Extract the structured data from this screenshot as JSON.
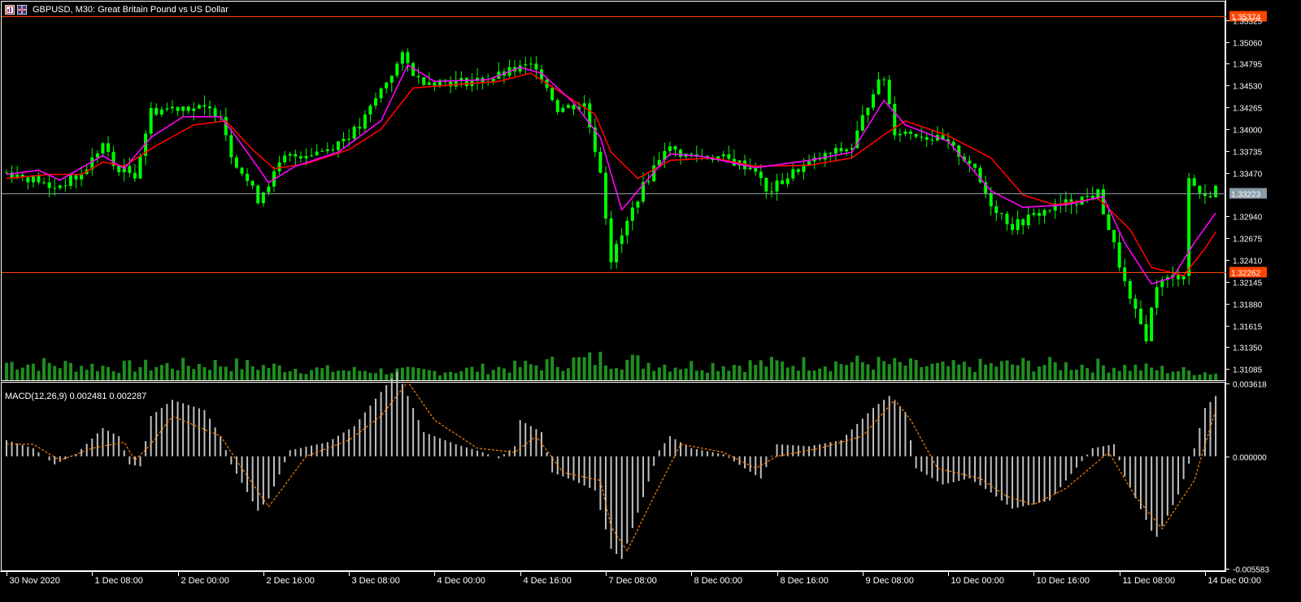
{
  "window": {
    "symbol_title": "GBPUSD, M30:  Great Britain Pound vs US Dollar"
  },
  "indicator": {
    "macd_label": "MACD(12,26,9) 0.002481 0.002287"
  },
  "colors": {
    "background": "#000000",
    "axis": "#ffffff",
    "candle": "#00ff00",
    "volume": "#1f8f1f",
    "ma_fast": "#ff00ff",
    "ma_slow": "#ff0000",
    "price_line_orange": "#ff4500",
    "price_line_gray": "#8a9ba8",
    "macd_hist": "#c0c0c0",
    "macd_signal": "#ff7f00"
  },
  "chart_data": [
    {
      "type": "line",
      "subtype": "candlestick",
      "title": "GBPUSD, M30:  Great Britain Pound vs US Dollar",
      "x_tick_labels": [
        "30 Nov 2020",
        "1 Dec 08:00",
        "2 Dec 00:00",
        "2 Dec 16:00",
        "3 Dec 08:00",
        "4 Dec 00:00",
        "4 Dec 16:00",
        "7 Dec 08:00",
        "8 Dec 00:00",
        "8 Dec 16:00",
        "9 Dec 08:00",
        "10 Dec 00:00",
        "10 Dec 16:00",
        "11 Dec 08:00",
        "14 Dec 00:00"
      ],
      "x_tick_index": [
        0,
        16,
        32,
        48,
        64,
        80,
        96,
        112,
        128,
        144,
        160,
        176,
        192,
        208,
        224
      ],
      "y_tick_labels": [
        "1.35325",
        "1.35060",
        "1.34795",
        "1.34530",
        "1.34265",
        "1.34000",
        "1.33735",
        "1.33470",
        "1.32940",
        "1.32675",
        "1.32410",
        "1.32145",
        "1.31880",
        "1.31615",
        "1.31350",
        "1.31085"
      ],
      "ylim": [
        1.3095,
        1.3545
      ],
      "price_markers": [
        {
          "label": "1.35374",
          "value": 1.35374,
          "color": "#ff4500"
        },
        {
          "label": "1.33223",
          "value": 1.33223,
          "color": "#8a9ba8"
        },
        {
          "label": "1.32262",
          "value": 1.32262,
          "color": "#ff4500"
        }
      ],
      "close_anchors": [
        [
          0,
          1.3347
        ],
        [
          6,
          1.3338
        ],
        [
          8,
          1.3327
        ],
        [
          14,
          1.3344
        ],
        [
          18,
          1.3382
        ],
        [
          20,
          1.3355
        ],
        [
          24,
          1.3345
        ],
        [
          27,
          1.3422
        ],
        [
          33,
          1.3428
        ],
        [
          40,
          1.342
        ],
        [
          42,
          1.337
        ],
        [
          47,
          1.3315
        ],
        [
          52,
          1.3365
        ],
        [
          60,
          1.3376
        ],
        [
          66,
          1.3402
        ],
        [
          70,
          1.3448
        ],
        [
          74,
          1.3488
        ],
        [
          77,
          1.346
        ],
        [
          84,
          1.3457
        ],
        [
          90,
          1.346
        ],
        [
          95,
          1.3472
        ],
        [
          99,
          1.3478
        ],
        [
          103,
          1.3425
        ],
        [
          108,
          1.343
        ],
        [
          111,
          1.335
        ],
        [
          113,
          1.3242
        ],
        [
          115,
          1.327
        ],
        [
          118,
          1.3318
        ],
        [
          123,
          1.3378
        ],
        [
          127,
          1.3368
        ],
        [
          133,
          1.3366
        ],
        [
          140,
          1.3352
        ],
        [
          142,
          1.3322
        ],
        [
          148,
          1.3352
        ],
        [
          154,
          1.337
        ],
        [
          158,
          1.3378
        ],
        [
          162,
          1.3448
        ],
        [
          164,
          1.3462
        ],
        [
          166,
          1.3398
        ],
        [
          170,
          1.3395
        ],
        [
          175,
          1.3385
        ],
        [
          180,
          1.336
        ],
        [
          184,
          1.331
        ],
        [
          188,
          1.3282
        ],
        [
          193,
          1.3298
        ],
        [
          198,
          1.331
        ],
        [
          204,
          1.3322
        ],
        [
          207,
          1.3258
        ],
        [
          210,
          1.319
        ],
        [
          213,
          1.3148
        ],
        [
          215,
          1.3212
        ],
        [
          220,
          1.3225
        ],
        [
          221,
          1.334
        ],
        [
          224,
          1.3315
        ],
        [
          226,
          1.333
        ]
      ],
      "ma_fast_anchors": [
        [
          0,
          1.3345
        ],
        [
          6,
          1.335
        ],
        [
          10,
          1.3338
        ],
        [
          18,
          1.3368
        ],
        [
          22,
          1.3352
        ],
        [
          27,
          1.339
        ],
        [
          33,
          1.3415
        ],
        [
          40,
          1.3415
        ],
        [
          43,
          1.339
        ],
        [
          49,
          1.3335
        ],
        [
          54,
          1.3355
        ],
        [
          62,
          1.3372
        ],
        [
          70,
          1.341
        ],
        [
          75,
          1.3478
        ],
        [
          80,
          1.3458
        ],
        [
          90,
          1.346
        ],
        [
          96,
          1.3475
        ],
        [
          100,
          1.3468
        ],
        [
          106,
          1.3432
        ],
        [
          111,
          1.339
        ],
        [
          115,
          1.3302
        ],
        [
          118,
          1.3325
        ],
        [
          124,
          1.337
        ],
        [
          130,
          1.3367
        ],
        [
          140,
          1.3353
        ],
        [
          150,
          1.3362
        ],
        [
          158,
          1.3372
        ],
        [
          164,
          1.3435
        ],
        [
          168,
          1.3405
        ],
        [
          176,
          1.3385
        ],
        [
          184,
          1.3325
        ],
        [
          190,
          1.3305
        ],
        [
          198,
          1.3308
        ],
        [
          205,
          1.3318
        ],
        [
          209,
          1.3262
        ],
        [
          214,
          1.3212
        ],
        [
          218,
          1.322
        ],
        [
          222,
          1.3262
        ],
        [
          226,
          1.3298
        ]
      ],
      "ma_slow_anchors": [
        [
          0,
          1.334
        ],
        [
          8,
          1.3345
        ],
        [
          14,
          1.3345
        ],
        [
          18,
          1.336
        ],
        [
          22,
          1.3355
        ],
        [
          28,
          1.338
        ],
        [
          35,
          1.3405
        ],
        [
          41,
          1.341
        ],
        [
          46,
          1.3375
        ],
        [
          50,
          1.3352
        ],
        [
          56,
          1.3358
        ],
        [
          64,
          1.3375
        ],
        [
          70,
          1.34
        ],
        [
          76,
          1.345
        ],
        [
          82,
          1.3453
        ],
        [
          92,
          1.3458
        ],
        [
          98,
          1.3468
        ],
        [
          104,
          1.3443
        ],
        [
          110,
          1.3418
        ],
        [
          113,
          1.3372
        ],
        [
          118,
          1.334
        ],
        [
          124,
          1.3362
        ],
        [
          132,
          1.3365
        ],
        [
          140,
          1.3355
        ],
        [
          150,
          1.3356
        ],
        [
          158,
          1.3365
        ],
        [
          164,
          1.3393
        ],
        [
          168,
          1.341
        ],
        [
          176,
          1.3392
        ],
        [
          184,
          1.3365
        ],
        [
          190,
          1.332
        ],
        [
          196,
          1.3308
        ],
        [
          204,
          1.3316
        ],
        [
          210,
          1.3278
        ],
        [
          214,
          1.3232
        ],
        [
          220,
          1.3222
        ],
        [
          224,
          1.3255
        ],
        [
          226,
          1.3275
        ]
      ],
      "volume_anchors": [
        [
          0,
          0.6
        ],
        [
          20,
          0.45
        ],
        [
          40,
          0.55
        ],
        [
          60,
          0.35
        ],
        [
          80,
          0.3
        ],
        [
          95,
          0.45
        ],
        [
          112,
          0.75
        ],
        [
          125,
          0.5
        ],
        [
          140,
          0.55
        ],
        [
          160,
          0.6
        ],
        [
          175,
          0.45
        ],
        [
          190,
          0.55
        ],
        [
          205,
          0.5
        ],
        [
          226,
          0.25
        ]
      ]
    },
    {
      "type": "bar",
      "title": "MACD(12,26,9) 0.002481 0.002287",
      "y_tick_labels": [
        "0.003618",
        "0.000000",
        "-0.005583"
      ],
      "ylim": [
        -0.005583,
        0.003618
      ],
      "main_value": 0.002481,
      "signal_value": 0.002287,
      "hist_anchors": [
        [
          0,
          0.0008
        ],
        [
          5,
          0.0004
        ],
        [
          9,
          -0.0004
        ],
        [
          13,
          0.0001
        ],
        [
          18,
          0.0014
        ],
        [
          21,
          0.001
        ],
        [
          23,
          -0.0004
        ],
        [
          25,
          -0.0005
        ],
        [
          27,
          0.002
        ],
        [
          31,
          0.0028
        ],
        [
          37,
          0.0023
        ],
        [
          40,
          0.001
        ],
        [
          42,
          -0.0004
        ],
        [
          47,
          -0.0027
        ],
        [
          49,
          -0.0021
        ],
        [
          53,
          0.0003
        ],
        [
          60,
          0.0007
        ],
        [
          65,
          0.0015
        ],
        [
          70,
          0.0032
        ],
        [
          73,
          0.0042
        ],
        [
          78,
          0.0012
        ],
        [
          84,
          0.0006
        ],
        [
          89,
          0.0002
        ],
        [
          92,
          -0.0001
        ],
        [
          95,
          0.0005
        ],
        [
          96,
          0.0018
        ],
        [
          100,
          0.0012
        ],
        [
          102,
          -0.0008
        ],
        [
          106,
          -0.0012
        ],
        [
          110,
          -0.0017
        ],
        [
          113,
          -0.0046
        ],
        [
          115,
          -0.0051
        ],
        [
          118,
          -0.0028
        ],
        [
          122,
          0.0003
        ],
        [
          124,
          0.001
        ],
        [
          128,
          0.0004
        ],
        [
          134,
          0.0001
        ],
        [
          138,
          -0.0006
        ],
        [
          141,
          -0.0011
        ],
        [
          144,
          0.0006
        ],
        [
          150,
          0.0005
        ],
        [
          156,
          0.0008
        ],
        [
          162,
          0.0024
        ],
        [
          165,
          0.003
        ],
        [
          168,
          0.0022
        ],
        [
          170,
          -0.0006
        ],
        [
          175,
          -0.0014
        ],
        [
          180,
          -0.0011
        ],
        [
          184,
          -0.0018
        ],
        [
          188,
          -0.0026
        ],
        [
          195,
          -0.0022
        ],
        [
          198,
          -0.0012
        ],
        [
          203,
          0.0004
        ],
        [
          207,
          0.0006
        ],
        [
          209,
          -0.001
        ],
        [
          214,
          -0.0037
        ],
        [
          215,
          -0.004
        ],
        [
          219,
          -0.0019
        ],
        [
          222,
          0.0004
        ],
        [
          224,
          0.0024
        ],
        [
          226,
          0.003
        ]
      ],
      "signal_anchors": [
        [
          0,
          0.0006
        ],
        [
          5,
          0.0006
        ],
        [
          10,
          -0.0002
        ],
        [
          16,
          0.0004
        ],
        [
          22,
          0.0007
        ],
        [
          24,
          -0.0002
        ],
        [
          27,
          0.0006
        ],
        [
          31,
          0.002
        ],
        [
          40,
          0.001
        ],
        [
          44,
          -0.0006
        ],
        [
          49,
          -0.0025
        ],
        [
          51,
          -0.0018
        ],
        [
          56,
          0.0
        ],
        [
          64,
          0.0008
        ],
        [
          70,
          0.002
        ],
        [
          75,
          0.0037
        ],
        [
          80,
          0.0018
        ],
        [
          88,
          0.0004
        ],
        [
          95,
          0.0002
        ],
        [
          99,
          0.001
        ],
        [
          104,
          -0.0008
        ],
        [
          111,
          -0.0012
        ],
        [
          113,
          -0.0035
        ],
        [
          116,
          -0.0047
        ],
        [
          121,
          -0.002
        ],
        [
          126,
          0.0006
        ],
        [
          134,
          0.0002
        ],
        [
          140,
          -0.0006
        ],
        [
          144,
          0.0
        ],
        [
          152,
          0.0004
        ],
        [
          160,
          0.001
        ],
        [
          166,
          0.0028
        ],
        [
          169,
          0.0018
        ],
        [
          174,
          -0.0006
        ],
        [
          182,
          -0.0011
        ],
        [
          187,
          -0.002
        ],
        [
          192,
          -0.0024
        ],
        [
          198,
          -0.0016
        ],
        [
          206,
          0.0002
        ],
        [
          211,
          -0.002
        ],
        [
          216,
          -0.0036
        ],
        [
          222,
          -0.0012
        ],
        [
          226,
          0.0023
        ]
      ]
    }
  ]
}
